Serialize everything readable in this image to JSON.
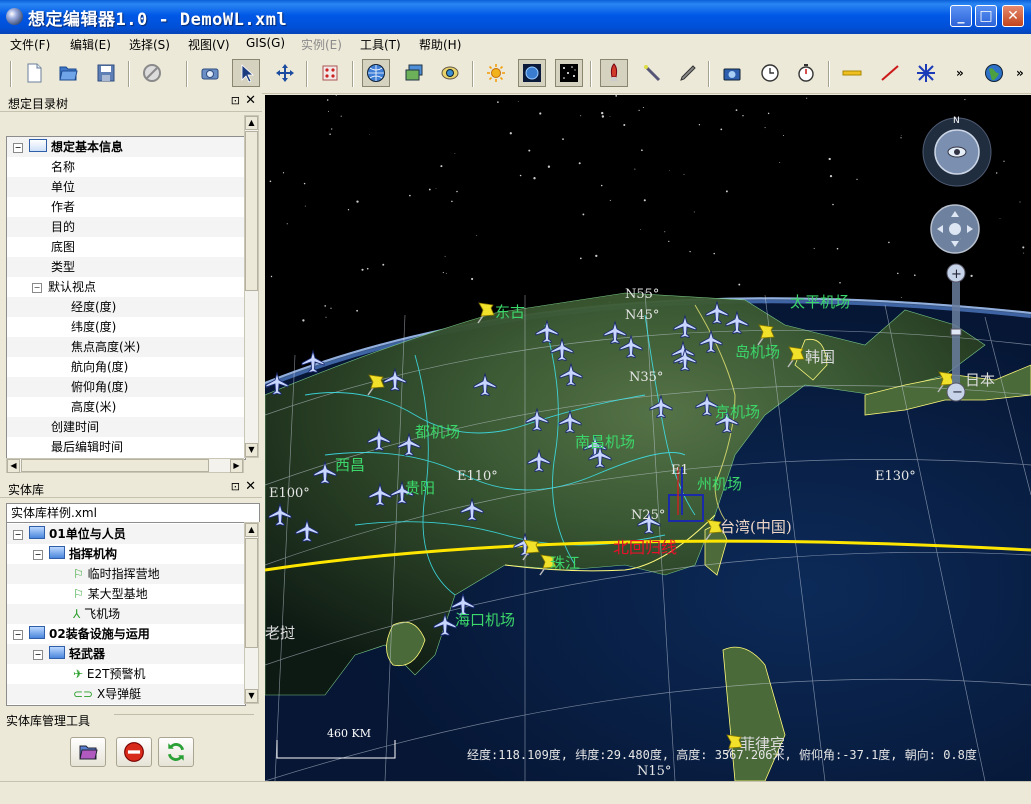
{
  "window": {
    "title": "想定编辑器1.0 - DemoWL.xml"
  },
  "menu": [
    "文件(F)",
    "编辑(E)",
    "选择(S)",
    "视图(V)",
    "GIS(G)",
    "实例(E)",
    "工具(T)",
    "帮助(H)"
  ],
  "toolbar": {
    "icons": [
      "new-file-icon",
      "open-folder-icon",
      "save-disk-icon",
      "stop-icon",
      "camera-icon",
      "select-pointer-icon",
      "move-cross-icon",
      "grid-dots-icon",
      "globe-view-icon",
      "layers-icon",
      "eye-icon",
      "sun-icon",
      "atmosphere-icon",
      "stars-icon",
      "rocket-icon",
      "missile-icon",
      "pen-icon",
      "snapshot-icon",
      "clock-icon",
      "timer-icon",
      "line-yellow-icon",
      "line-red-icon",
      "asterisk-icon",
      "earth-icon"
    ],
    "overflow": "»"
  },
  "scenario_panel": {
    "title": "想定目录树",
    "root": "想定基本信息",
    "items": [
      "名称",
      "单位",
      "作者",
      "目的",
      "底图",
      "类型",
      "默认视点"
    ],
    "viewpoint_items": [
      "经度(度)",
      "纬度(度)",
      "焦点高度(米)",
      "航向角(度)",
      "俯仰角(度)",
      "高度(米)"
    ],
    "tail_items": [
      "创建时间",
      "最后编辑时间"
    ]
  },
  "entity_panel": {
    "title": "实体库",
    "file": "实体库样例.xml",
    "nodes": [
      "01单位与人员",
      "指挥机构",
      "临时指挥营地",
      "某大型基地",
      "飞机场",
      "02装备设施与运用",
      "轻武器",
      "E2T预警机",
      "X导弹艇"
    ],
    "tools_title": "实体库管理工具"
  },
  "globe": {
    "labels": {
      "tropic": "北回归线",
      "taiwan": "台湾(中国)",
      "korea": "韩国",
      "japan": "日本",
      "philippines": "菲律宾",
      "laos": "老挝",
      "haikou": "海口机场",
      "guiyang": "贵阳",
      "zhengzhou": "州机场",
      "east": "东古",
      "xiping": "西昌",
      "airport_ne": "太平机场",
      "airport_jp": "岛机场",
      "pearl": "珠江",
      "hangzhou": "京机场",
      "nanchang": "南昌机场",
      "chengdu": "都机场"
    },
    "grid": {
      "n45": "N45°",
      "n35": "N35°",
      "n25": "N25°",
      "n15": "N15°",
      "n55": "N55°",
      "e110": "E110°",
      "e130": "E130°",
      "e100": "E100°",
      "e120": "E1"
    },
    "scale": "460 KM",
    "compass": "N",
    "status": "经度:118.109度, 纬度:29.480度, 高度: 3567.206米, 俯仰角:-37.1度, 朝向: 0.8度"
  }
}
